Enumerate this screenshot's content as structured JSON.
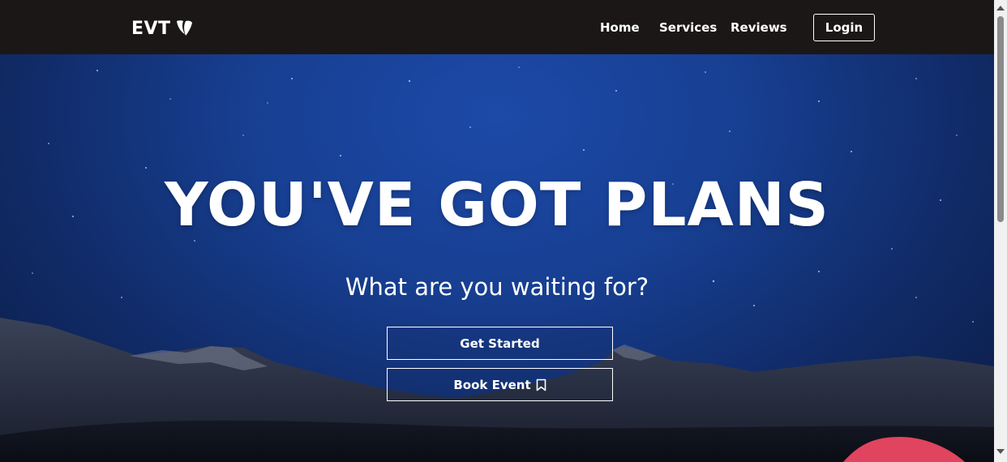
{
  "nav": {
    "brand": "EVT",
    "brand_icon": "typo3-logo-icon",
    "links": [
      "Home",
      "Services",
      "Reviews"
    ],
    "login_label": "Login"
  },
  "hero": {
    "title": "YOU'VE GOT PLANS",
    "subtitle": "What are you waiting for?",
    "get_started_label": "Get Started",
    "book_event_label": "Book Event",
    "book_event_icon": "bookmark-icon"
  },
  "colors": {
    "navbar": "#1c1717",
    "sky_top": "#1d4aa8",
    "sky_bottom": "#0b1c43",
    "text": "#ffffff",
    "tent": "#e0445e"
  }
}
